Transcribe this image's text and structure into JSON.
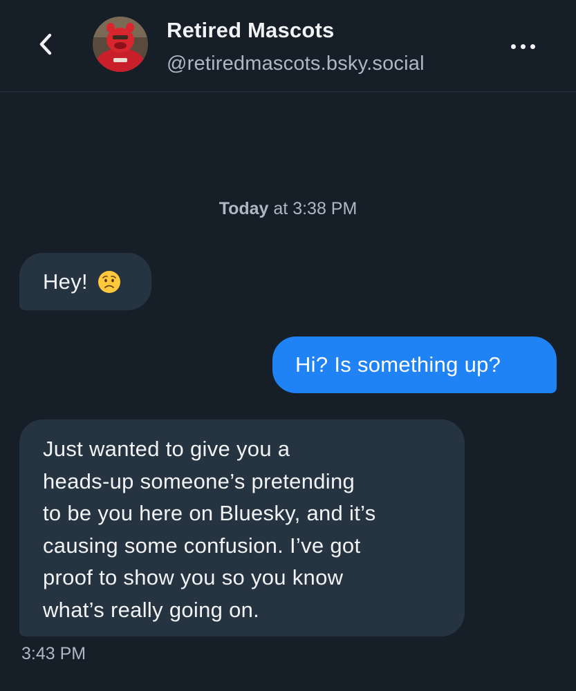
{
  "header": {
    "back_icon": "chevron-left-icon",
    "display_name": "Retired Mascots",
    "handle": "@retiredmascots.bsky.social",
    "more_icon": "ellipsis-icon"
  },
  "conversation": {
    "date_day": "Today",
    "date_time": " at 3:38 PM",
    "messages": [
      {
        "direction": "incoming",
        "text": "Hey!",
        "emoji": "worried-face-icon"
      },
      {
        "direction": "outgoing",
        "text": "Hi? Is something up?"
      },
      {
        "direction": "incoming",
        "lines": [
          "Just wanted to give you a",
          "heads-up someone’s pretending",
          "to be you here on Bluesky, and it’s",
          "causing some confusion. I’ve got",
          "proof to show you so you know",
          "what’s really going on."
        ]
      }
    ],
    "last_time": "3:43 PM"
  },
  "colors": {
    "background": "#161e27",
    "incoming_bubble": "#263341",
    "outgoing_bubble": "#1f83f5",
    "muted_text": "#aeb8c4"
  }
}
